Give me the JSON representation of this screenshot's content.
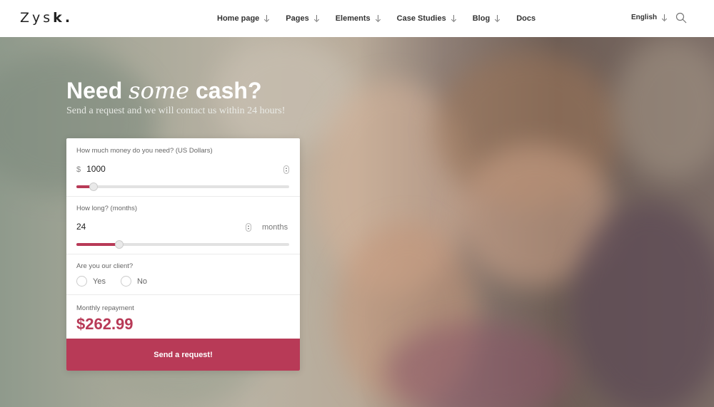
{
  "brand": {
    "logo_light": "Zys",
    "logo_bold": "k",
    "logo_dot": "."
  },
  "nav": {
    "items": [
      {
        "label": "Home page",
        "has_dropdown": true
      },
      {
        "label": "Pages",
        "has_dropdown": true
      },
      {
        "label": "Elements",
        "has_dropdown": true
      },
      {
        "label": "Case Studies",
        "has_dropdown": true
      },
      {
        "label": "Blog",
        "has_dropdown": true
      },
      {
        "label": "Docs",
        "has_dropdown": false
      }
    ],
    "language": "English",
    "search_icon": "search-icon"
  },
  "hero": {
    "headline_start": "Need",
    "headline_italic": "some",
    "headline_end": "cash?",
    "subline": "Send a request and we will contact us within 24 hours!"
  },
  "form": {
    "amount": {
      "label": "How much money do you need? (US Dollars)",
      "currency": "$",
      "value": "1000",
      "slider_fraction": 0.08
    },
    "duration": {
      "label": "How long? (months)",
      "value": "24",
      "unit": "months",
      "slider_fraction": 0.2
    },
    "client": {
      "label": "Are you our client?",
      "options": [
        "Yes",
        "No"
      ]
    },
    "repayment": {
      "label": "Monthly repayment",
      "value": "$262.99"
    },
    "submit_label": "Send a request!"
  },
  "colors": {
    "accent": "#b83a57",
    "track": "#e2e2e2"
  }
}
